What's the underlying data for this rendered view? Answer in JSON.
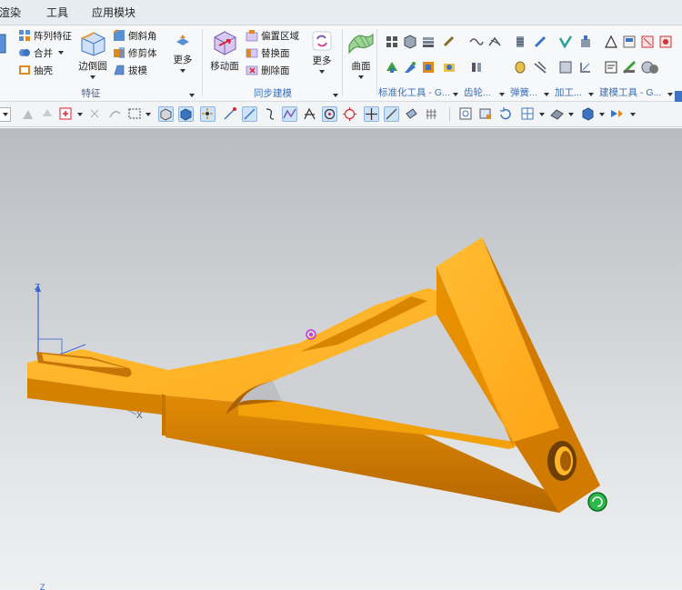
{
  "menubar": {
    "items": [
      "渲染",
      "工具",
      "应用模块"
    ]
  },
  "ribbon": {
    "feature": {
      "label": "特征",
      "commands": [
        "阵列特征",
        "合并",
        "抽壳",
        "边倒圆",
        "倒斜角",
        "修剪体",
        "拔模",
        "更多"
      ]
    },
    "sync": {
      "label": "同步建模",
      "commands": [
        "移动面",
        "偏置区域",
        "替换面",
        "删除面",
        "更多"
      ]
    },
    "surface": {
      "command": "曲面"
    },
    "tabs": [
      "标准化工具 - G...",
      "齿轮...",
      "弹簧...",
      "加工...",
      "建模工具 - G..."
    ]
  },
  "viewport": {
    "triad": {
      "x": "X",
      "z": "Z"
    },
    "bottom_triad_z": "Z",
    "colors": {
      "part_light": "#ffb21f",
      "part_mid": "#f29a06",
      "part_dark": "#b96a00",
      "bg_top": "#b9bcc0",
      "bg_bottom": "#eef0f1"
    }
  }
}
